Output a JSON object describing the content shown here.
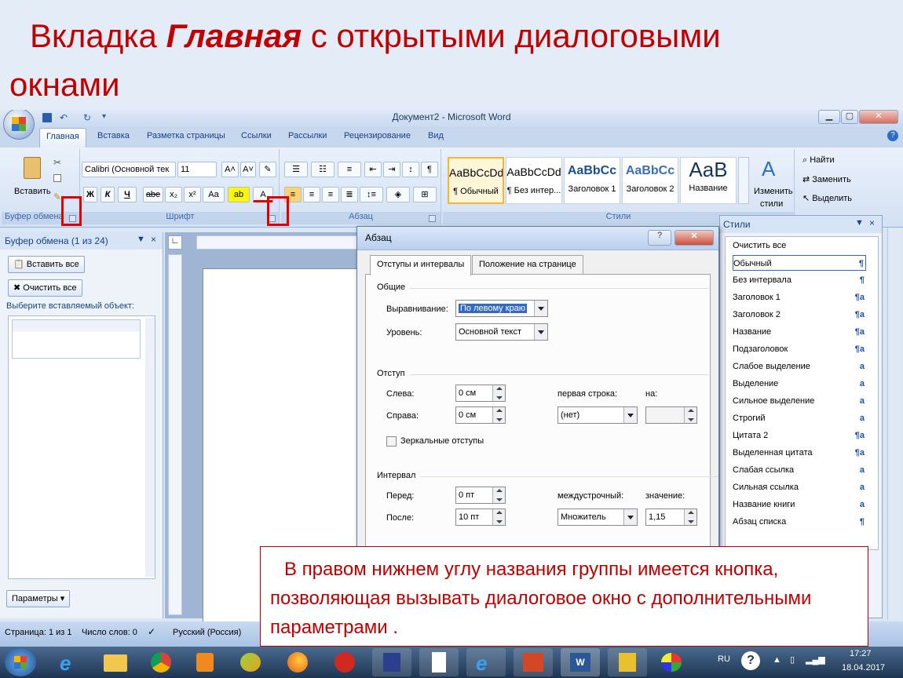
{
  "slide": {
    "title_part1": "Вкладка ",
    "title_bold": "Главная",
    "title_part2": " с открытыми диалоговыми",
    "title_line2": "окнами"
  },
  "window": {
    "title": "Документ2 - Microsoft Word"
  },
  "tabs": [
    "Главная",
    "Вставка",
    "Разметка страницы",
    "Ссылки",
    "Рассылки",
    "Рецензирование",
    "Вид"
  ],
  "ribbon": {
    "clipboard": {
      "paste_label": "Вставить",
      "group_label": "Буфер обмена"
    },
    "font": {
      "font_name": "Calibri (Основной тек",
      "font_size": "11",
      "group_label": "Шрифт",
      "bold": "Ж",
      "italic": "К",
      "underline": "Ч",
      "strike": "abe",
      "sub": "x₂",
      "sup": "x²",
      "case": "Aa"
    },
    "paragraph": {
      "group_label": "Абзац"
    },
    "styles": {
      "group_label": "Стили",
      "items": [
        {
          "preview": "AaBbCcDd",
          "name": "¶ Обычный"
        },
        {
          "preview": "AaBbCcDd",
          "name": "¶ Без интер..."
        },
        {
          "preview": "AaBbCc",
          "name": "Заголовок 1"
        },
        {
          "preview": "AaBbCc",
          "name": "Заголовок 2"
        },
        {
          "preview": "AaB",
          "name": "Название"
        }
      ],
      "change_label_1": "Изменить",
      "change_label_2": "стили"
    },
    "editing": {
      "find": "Найти",
      "replace": "Заменить",
      "select": "Выделить"
    }
  },
  "clipboard_pane": {
    "title": "Буфер обмена (1 из 24)",
    "paste_all": "Вставить все",
    "clear_all": "Очистить все",
    "prompt": "Выберите вставляемый объект:",
    "options": "Параметры"
  },
  "styles_pane": {
    "title": "Стили",
    "items": [
      {
        "name": "Очистить все",
        "mark": ""
      },
      {
        "name": "Обычный",
        "mark": "¶"
      },
      {
        "name": "Без интервала",
        "mark": "¶"
      },
      {
        "name": "Заголовок 1",
        "mark": "¶a"
      },
      {
        "name": "Заголовок 2",
        "mark": "¶a"
      },
      {
        "name": "Название",
        "mark": "¶a"
      },
      {
        "name": "Подзаголовок",
        "mark": "¶a"
      },
      {
        "name": "Слабое выделение",
        "mark": "a"
      },
      {
        "name": "Выделение",
        "mark": "a"
      },
      {
        "name": "Сильное выделение",
        "mark": "a"
      },
      {
        "name": "Строгий",
        "mark": "a"
      },
      {
        "name": "Цитата 2",
        "mark": "¶a"
      },
      {
        "name": "Выделенная цитата",
        "mark": "¶a"
      },
      {
        "name": "Слабая ссылка",
        "mark": "a"
      },
      {
        "name": "Сильная ссылка",
        "mark": "a"
      },
      {
        "name": "Название книги",
        "mark": "a"
      },
      {
        "name": "Абзац списка",
        "mark": "¶"
      }
    ]
  },
  "dialog": {
    "title": "Абзац",
    "tab1": "Отступы и интервалы",
    "tab2": "Положение на странице",
    "general": "Общие",
    "alignment_label": "Выравнивание:",
    "alignment_value": "По левому краю",
    "level_label": "Уровень:",
    "level_value": "Основной текст",
    "indent": "Отступ",
    "left_label": "Слева:",
    "left_value": "0 см",
    "right_label": "Справа:",
    "right_value": "0 см",
    "first_line_label": "первая строка:",
    "first_line_value": "(нет)",
    "on_label": "на:",
    "mirror_label": "Зеркальные отступы",
    "spacing": "Интервал",
    "before_label": "Перед:",
    "before_value": "0 пт",
    "after_label": "После:",
    "after_value": "10 пт",
    "line_label": "междустрочный:",
    "line_value": "Множитель",
    "value_label": "значение:",
    "value_value": "1,15"
  },
  "status": {
    "page": "Страница: 1 из 1",
    "words": "Число слов: 0",
    "lang": "Русский (Россия)"
  },
  "callout": {
    "text": "В правом нижнем углу названия группы имеется кнопка, позволяющая вызывать диалоговое окно с дополнительными параметрами ."
  },
  "taskbar": {
    "lang": "RU",
    "time": "17:27",
    "date": "18.04.2017"
  },
  "colors": {
    "accent": "#c00000",
    "ribbon": "#dbe6f5",
    "highlight": "#316ac5"
  }
}
